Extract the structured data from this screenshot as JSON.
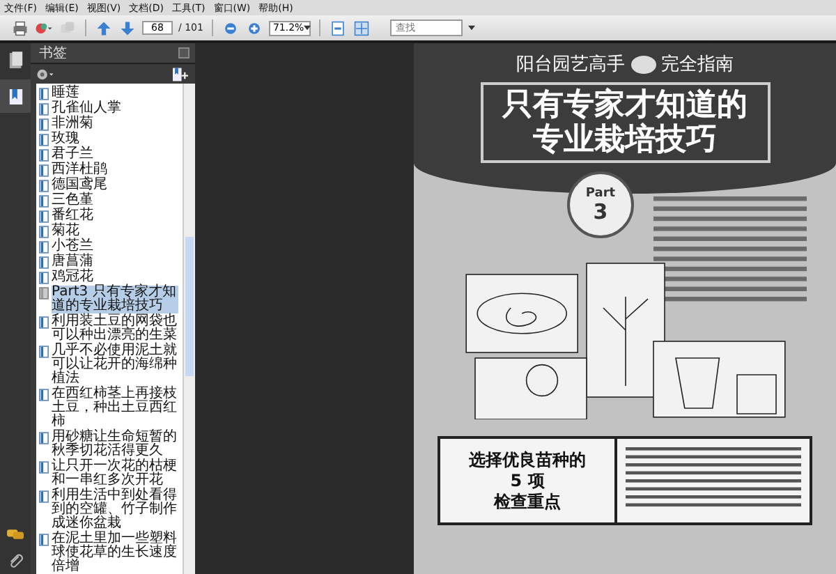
{
  "menu": [
    "文件(F)",
    "编辑(E)",
    "视图(V)",
    "文档(D)",
    "工具(T)",
    "窗口(W)",
    "帮助(H)"
  ],
  "toolbar": {
    "page": "68",
    "page_count": "/ 101",
    "zoom": "71.2%",
    "search": {
      "placeholder": "查找"
    }
  },
  "sidebar": {
    "tabs": [
      {
        "kind": "pages",
        "selected": false
      },
      {
        "kind": "bookmarks",
        "selected": true
      }
    ],
    "panel_title": "书签",
    "bookmarks": [
      {
        "label": "睡莲",
        "kind": "page",
        "selected": false
      },
      {
        "label": "孔雀仙人掌",
        "kind": "page",
        "selected": false
      },
      {
        "label": "非洲菊",
        "kind": "page",
        "selected": false
      },
      {
        "label": "玫瑰",
        "kind": "page",
        "selected": false
      },
      {
        "label": "君子兰",
        "kind": "page",
        "selected": false
      },
      {
        "label": "西洋杜鹃",
        "kind": "page",
        "selected": false
      },
      {
        "label": "德国鸢尾",
        "kind": "page",
        "selected": false
      },
      {
        "label": "三色堇",
        "kind": "page",
        "selected": false
      },
      {
        "label": "番红花",
        "kind": "page",
        "selected": false
      },
      {
        "label": "菊花",
        "kind": "page",
        "selected": false
      },
      {
        "label": "小苍兰",
        "kind": "page",
        "selected": false
      },
      {
        "label": "唐菖蒲",
        "kind": "page",
        "selected": false
      },
      {
        "label": "鸡冠花",
        "kind": "page",
        "selected": false
      },
      {
        "label": "Part3 只有专家才知道的专业栽培技巧",
        "kind": "part",
        "selected": true
      },
      {
        "label": "利用装土豆的网袋也可以种出漂亮的生菜",
        "kind": "page",
        "selected": false
      },
      {
        "label": "几乎不必使用泥土就可以让花开的海绵种植法",
        "kind": "page",
        "selected": false
      },
      {
        "label": "在西红柿茎上再接枝土豆，种出土豆西红柿",
        "kind": "page",
        "selected": false
      },
      {
        "label": "用砂糖让生命短暂的秋季切花活得更久",
        "kind": "page",
        "selected": false
      },
      {
        "label": "让只开一次花的枯梗和一串红多次开花",
        "kind": "page",
        "selected": false
      },
      {
        "label": "利用生活中到处看得到的空罐、竹子制作成迷你盆栽",
        "kind": "page",
        "selected": false
      },
      {
        "label": "在泥土里加一些塑料球使花草的生长速度倍增",
        "kind": "page",
        "selected": false
      }
    ]
  },
  "page": {
    "series": "阳台园艺高手",
    "series_suffix": "完全指南",
    "title_lines": [
      "只有专家才知道的",
      "专业栽培技巧"
    ],
    "part_label": "Part",
    "part_number": "3",
    "box_title_lines": [
      "选择优良苗种的",
      "5 项",
      "检查重点"
    ]
  }
}
